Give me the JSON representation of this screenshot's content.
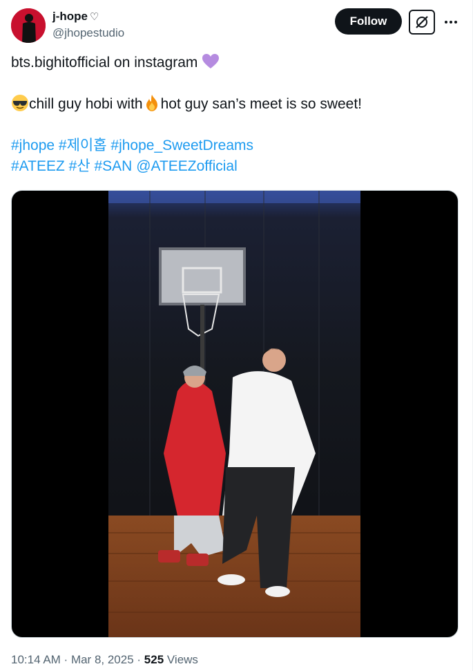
{
  "author": {
    "display_name": "j-hope",
    "heart_glyph": "♡",
    "handle": "@jhopestudio"
  },
  "actions": {
    "follow_label": "Follow",
    "more_glyph": "···"
  },
  "tweet": {
    "line1_text": "bts.bighitofficial on instagram ",
    "line1_emoji": "purple-heart",
    "line2_part1": "chill guy hobi with",
    "line2_part2": "hot guy san’s meet is so sweet!",
    "line2_emoji1": "sunglasses-face",
    "line2_emoji2": "fire",
    "hashtags_line1": [
      "#jhope",
      "#제이홉",
      "#jhope_SweetDreams"
    ],
    "hashtags_line2": [
      "#ATEEZ",
      "#산",
      "#SAN",
      "@ATEEZofficial"
    ]
  },
  "meta": {
    "time": "10:14 AM",
    "separator": " · ",
    "date": "Mar 8, 2025",
    "views_count": "525",
    "views_label": " Views"
  },
  "colors": {
    "link": "#1d9bf0",
    "text": "#0f1419",
    "muted": "#536471",
    "follow_bg": "#0f1419"
  }
}
